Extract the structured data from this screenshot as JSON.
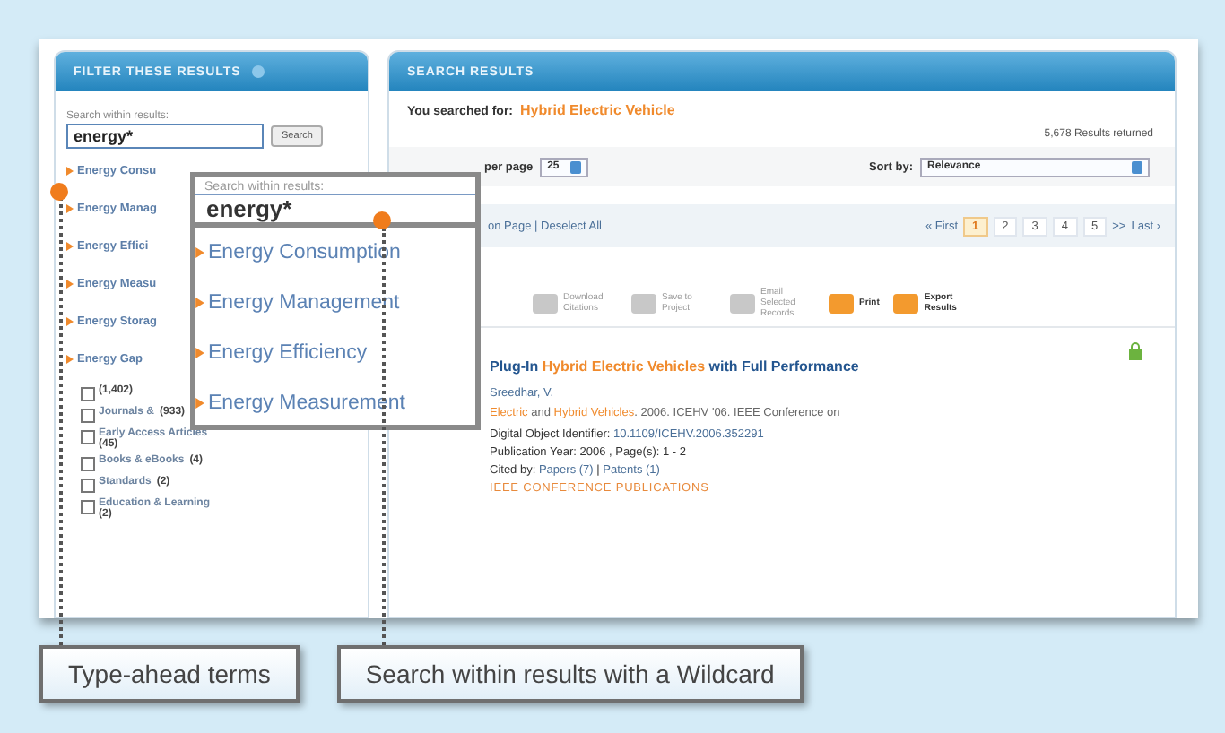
{
  "filter_panel": {
    "title": "FILTER THESE RESULTS",
    "search_label": "Search within results:",
    "search_value": "energy*",
    "search_button": "Search",
    "terms": [
      "Energy Consu",
      "Energy Manag",
      "Energy Effici",
      "Energy Measu",
      "Energy Storag",
      "Energy Gap"
    ],
    "content_types": [
      {
        "count": "(1,402)",
        "checked": false
      },
      {
        "label": "Journals &",
        "count": "(933)",
        "checked": false
      },
      {
        "label": "Early Access Articles",
        "count": "(45)",
        "checked": false
      },
      {
        "label": "Books & eBooks",
        "count": "(4)",
        "checked": false
      },
      {
        "label": "Standards",
        "count": "(2)",
        "checked": false
      },
      {
        "label": "Education & Learning",
        "count": "(2)",
        "checked": false
      }
    ]
  },
  "results_panel": {
    "title": "SEARCH RESULTS",
    "searched_label": "You searched for:",
    "searched_term": "Hybrid Electric Vehicle",
    "results_count": "5,678 Results returned",
    "per_page_label": "per page",
    "per_page_value": "25",
    "sort_label": "Sort by:",
    "sort_value": "Relevance",
    "selection_text": "on Page | Deselect All",
    "pagination": {
      "first": "« First",
      "pages": [
        {
          "label": "1",
          "selected": true
        },
        {
          "label": "2",
          "selected": false
        },
        {
          "label": "3",
          "selected": false
        },
        {
          "label": "4",
          "selected": false
        },
        {
          "label": "5",
          "selected": false
        }
      ],
      "next": ">>",
      "last": "Last ›"
    },
    "tools": [
      {
        "label": "Download Citations",
        "disabled": true
      },
      {
        "label": "Save to Project",
        "disabled": true
      },
      {
        "label": "Email Selected Records",
        "disabled": true
      },
      {
        "label": "Print",
        "disabled": false
      },
      {
        "label": "Export Results",
        "disabled": false
      }
    ],
    "result": {
      "title": "Plug-In **Hybrid Electric Vehicles** with Full Performance",
      "author": "Sreedhar, V.",
      "source": "**Electric** and **Hybrid Vehicles**. 2006. ICEHV '06. IEEE Conference on",
      "doi_label": "Digital Object Identifier:",
      "doi": "10.1109/ICEHV.2006.352291",
      "pub_info": "Publication Year: 2006 , Page(s): 1 - 2",
      "cited_label": "Cited by:",
      "cited_papers": "Papers (7)",
      "cited_separator": "|",
      "cited_patents": "Patents (1)",
      "publisher": "IEEE CONFERENCE PUBLICATIONS"
    }
  },
  "popup": {
    "search_label": "Search within results:",
    "search_value": "energy*",
    "suggestions": [
      "Energy Consumption",
      "Energy Management",
      "Energy Efficiency",
      "Energy Measurement"
    ]
  },
  "callouts": [
    "Type-ahead terms",
    "Search within results with a Wildcard"
  ]
}
